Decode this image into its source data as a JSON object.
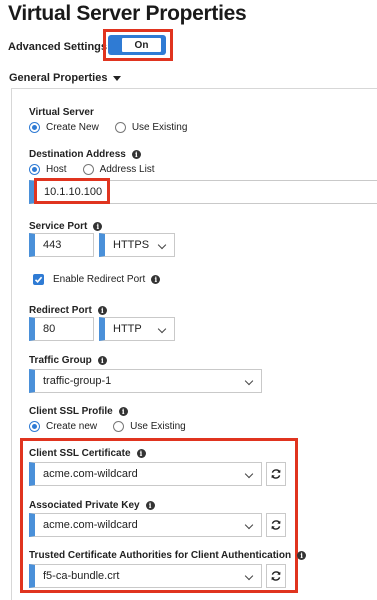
{
  "page": {
    "title": "Virtual Server Properties"
  },
  "advanced": {
    "label": "Advanced Settings",
    "toggle_text": "On"
  },
  "general": {
    "label": "General Properties"
  },
  "virtual_server": {
    "label": "Virtual Server",
    "options": [
      "Create New",
      "Use Existing"
    ],
    "selected": "Create New"
  },
  "destination": {
    "label": "Destination Address",
    "options": [
      "Host",
      "Address List"
    ],
    "selected": "Host",
    "value": "10.1.10.100"
  },
  "service_port": {
    "label": "Service Port",
    "port": "443",
    "protocol": "HTTPS"
  },
  "redirect_enable": {
    "label": "Enable Redirect Port",
    "checked": true
  },
  "redirect_port": {
    "label": "Redirect Port",
    "port": "80",
    "protocol": "HTTP"
  },
  "traffic_group": {
    "label": "Traffic Group",
    "value": "traffic-group-1"
  },
  "client_ssl": {
    "label": "Client SSL Profile",
    "options": [
      "Create new",
      "Use Existing"
    ],
    "selected": "Create new"
  },
  "cert": {
    "label": "Client SSL Certificate",
    "value": "acme.com-wildcard"
  },
  "key": {
    "label": "Associated Private Key",
    "value": "acme.com-wildcard"
  },
  "trusted_ca": {
    "label": "Trusted Certificate Authorities for Client Authentication",
    "value": "f5-ca-bundle.crt"
  },
  "colors": {
    "accent": "#2f7bd4",
    "highlight": "#e0341f",
    "field_bar": "#4a90d9"
  }
}
